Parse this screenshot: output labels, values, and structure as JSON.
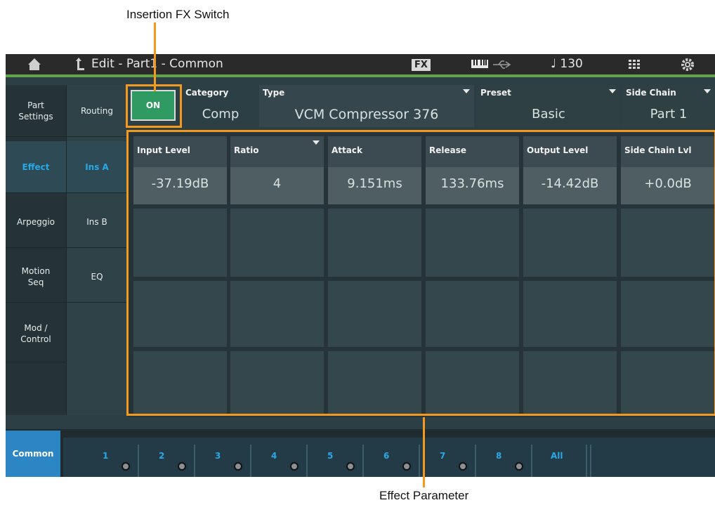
{
  "callouts": {
    "insertion_fx_switch": "Insertion FX Switch",
    "effect_parameter": "Effect Parameter"
  },
  "topbar": {
    "title": "Edit - Part1 - Common",
    "fx_badge": "FX",
    "tempo": "♩ 130",
    "icons": [
      "home-icon",
      "back-arrow-icon",
      "fx-icon",
      "keyboard-icon",
      "usb-icon",
      "grid-icon",
      "settings-gear-icon"
    ]
  },
  "nav_left": [
    "Part Settings",
    "Effect",
    "Arpeggio",
    "Motion Seq",
    "Mod / Control"
  ],
  "nav_sub": [
    "Routing",
    "Ins A",
    "Ins B",
    "EQ"
  ],
  "switch": {
    "label": "ON"
  },
  "header": {
    "category_label": "Category",
    "category_value": "Comp",
    "type_label": "Type",
    "type_value": "VCM Compressor 376",
    "preset_label": "Preset",
    "preset_value": "Basic",
    "sidechain_label": "Side Chain",
    "sidechain_value": "Part 1"
  },
  "params": [
    {
      "label": "Input Level",
      "value": "-37.19dB"
    },
    {
      "label": "Ratio",
      "value": "4"
    },
    {
      "label": "Attack",
      "value": "9.151ms"
    },
    {
      "label": "Release",
      "value": "133.76ms"
    },
    {
      "label": "Output Level",
      "value": "-14.42dB"
    },
    {
      "label": "Side Chain Lvl",
      "value": "+0.0dB"
    }
  ],
  "bottom_tabs": [
    "Common",
    "1",
    "2",
    "3",
    "4",
    "5",
    "6",
    "7",
    "8",
    "All"
  ],
  "colors": {
    "accent_blue": "#27a8e6",
    "switch_green": "#2f9b63",
    "callout_orange": "#f39a1e",
    "topbar_green": "#62a24b"
  }
}
